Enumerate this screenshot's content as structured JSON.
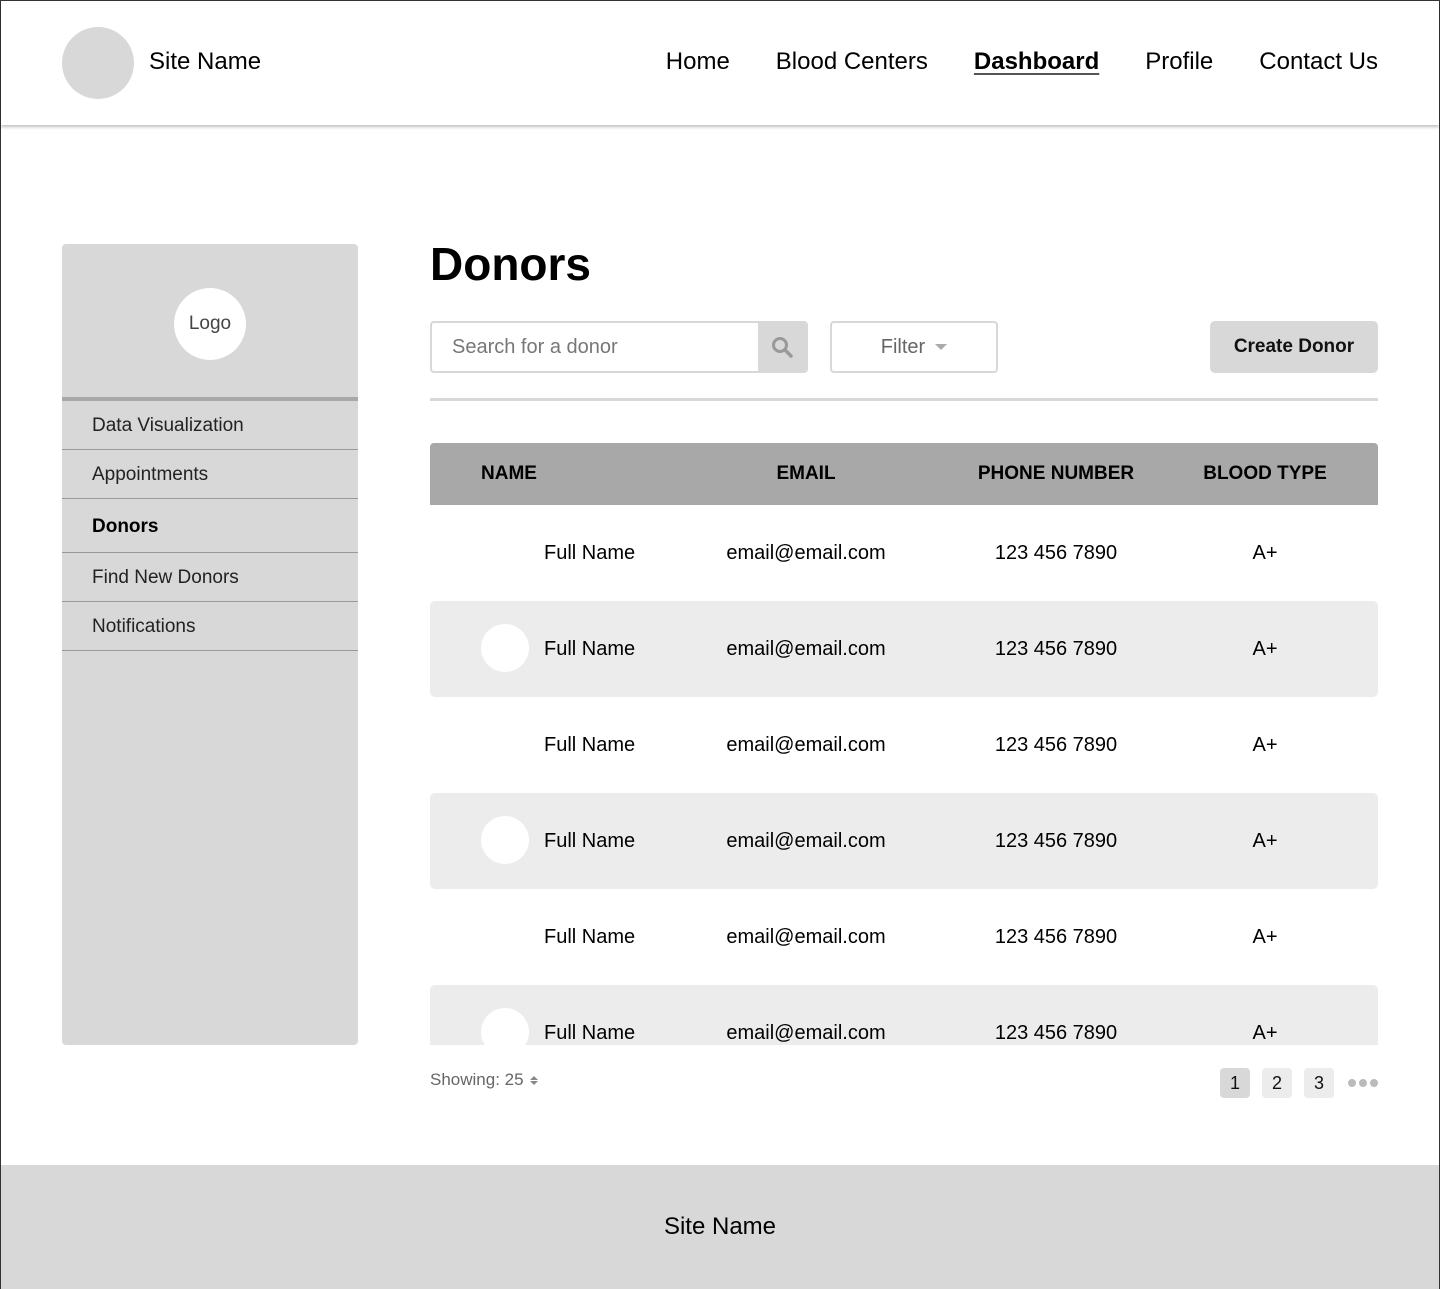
{
  "header": {
    "site_name": "Site Name",
    "nav": [
      {
        "label": "Home",
        "active": false
      },
      {
        "label": "Blood Centers",
        "active": false
      },
      {
        "label": "Dashboard",
        "active": true
      },
      {
        "label": "Profile",
        "active": false
      },
      {
        "label": "Contact Us",
        "active": false
      }
    ]
  },
  "sidebar": {
    "logo_label": "Logo",
    "items": [
      {
        "label": "Data Visualization",
        "active": false
      },
      {
        "label": "Appointments",
        "active": false
      },
      {
        "label": "Donors",
        "active": true
      },
      {
        "label": "Find New Donors",
        "active": false
      },
      {
        "label": "Notifications",
        "active": false
      }
    ]
  },
  "main": {
    "title": "Donors",
    "search": {
      "placeholder": "Search for a donor",
      "value": "",
      "icon": "search-icon"
    },
    "filter": {
      "label": "Filter",
      "icon": "caret-down-icon"
    },
    "create_button": "Create Donor",
    "table": {
      "columns": [
        "NAME",
        "EMAIL",
        "PHONE NUMBER",
        "BLOOD TYPE"
      ],
      "rows": [
        {
          "name": "Full Name",
          "email": "email@email.com",
          "phone": "123 456 7890",
          "blood_type": "A+"
        },
        {
          "name": "Full Name",
          "email": "email@email.com",
          "phone": "123 456 7890",
          "blood_type": "A+"
        },
        {
          "name": "Full Name",
          "email": "email@email.com",
          "phone": "123 456 7890",
          "blood_type": "A+"
        },
        {
          "name": "Full Name",
          "email": "email@email.com",
          "phone": "123 456 7890",
          "blood_type": "A+"
        },
        {
          "name": "Full Name",
          "email": "email@email.com",
          "phone": "123 456 7890",
          "blood_type": "A+"
        },
        {
          "name": "Full Name",
          "email": "email@email.com",
          "phone": "123 456 7890",
          "blood_type": "A+"
        }
      ]
    },
    "pagination": {
      "showing_label": "Showing: 25",
      "pages": [
        "1",
        "2",
        "3"
      ],
      "current_page": "1"
    }
  },
  "footer": {
    "site_name": "Site Name"
  }
}
